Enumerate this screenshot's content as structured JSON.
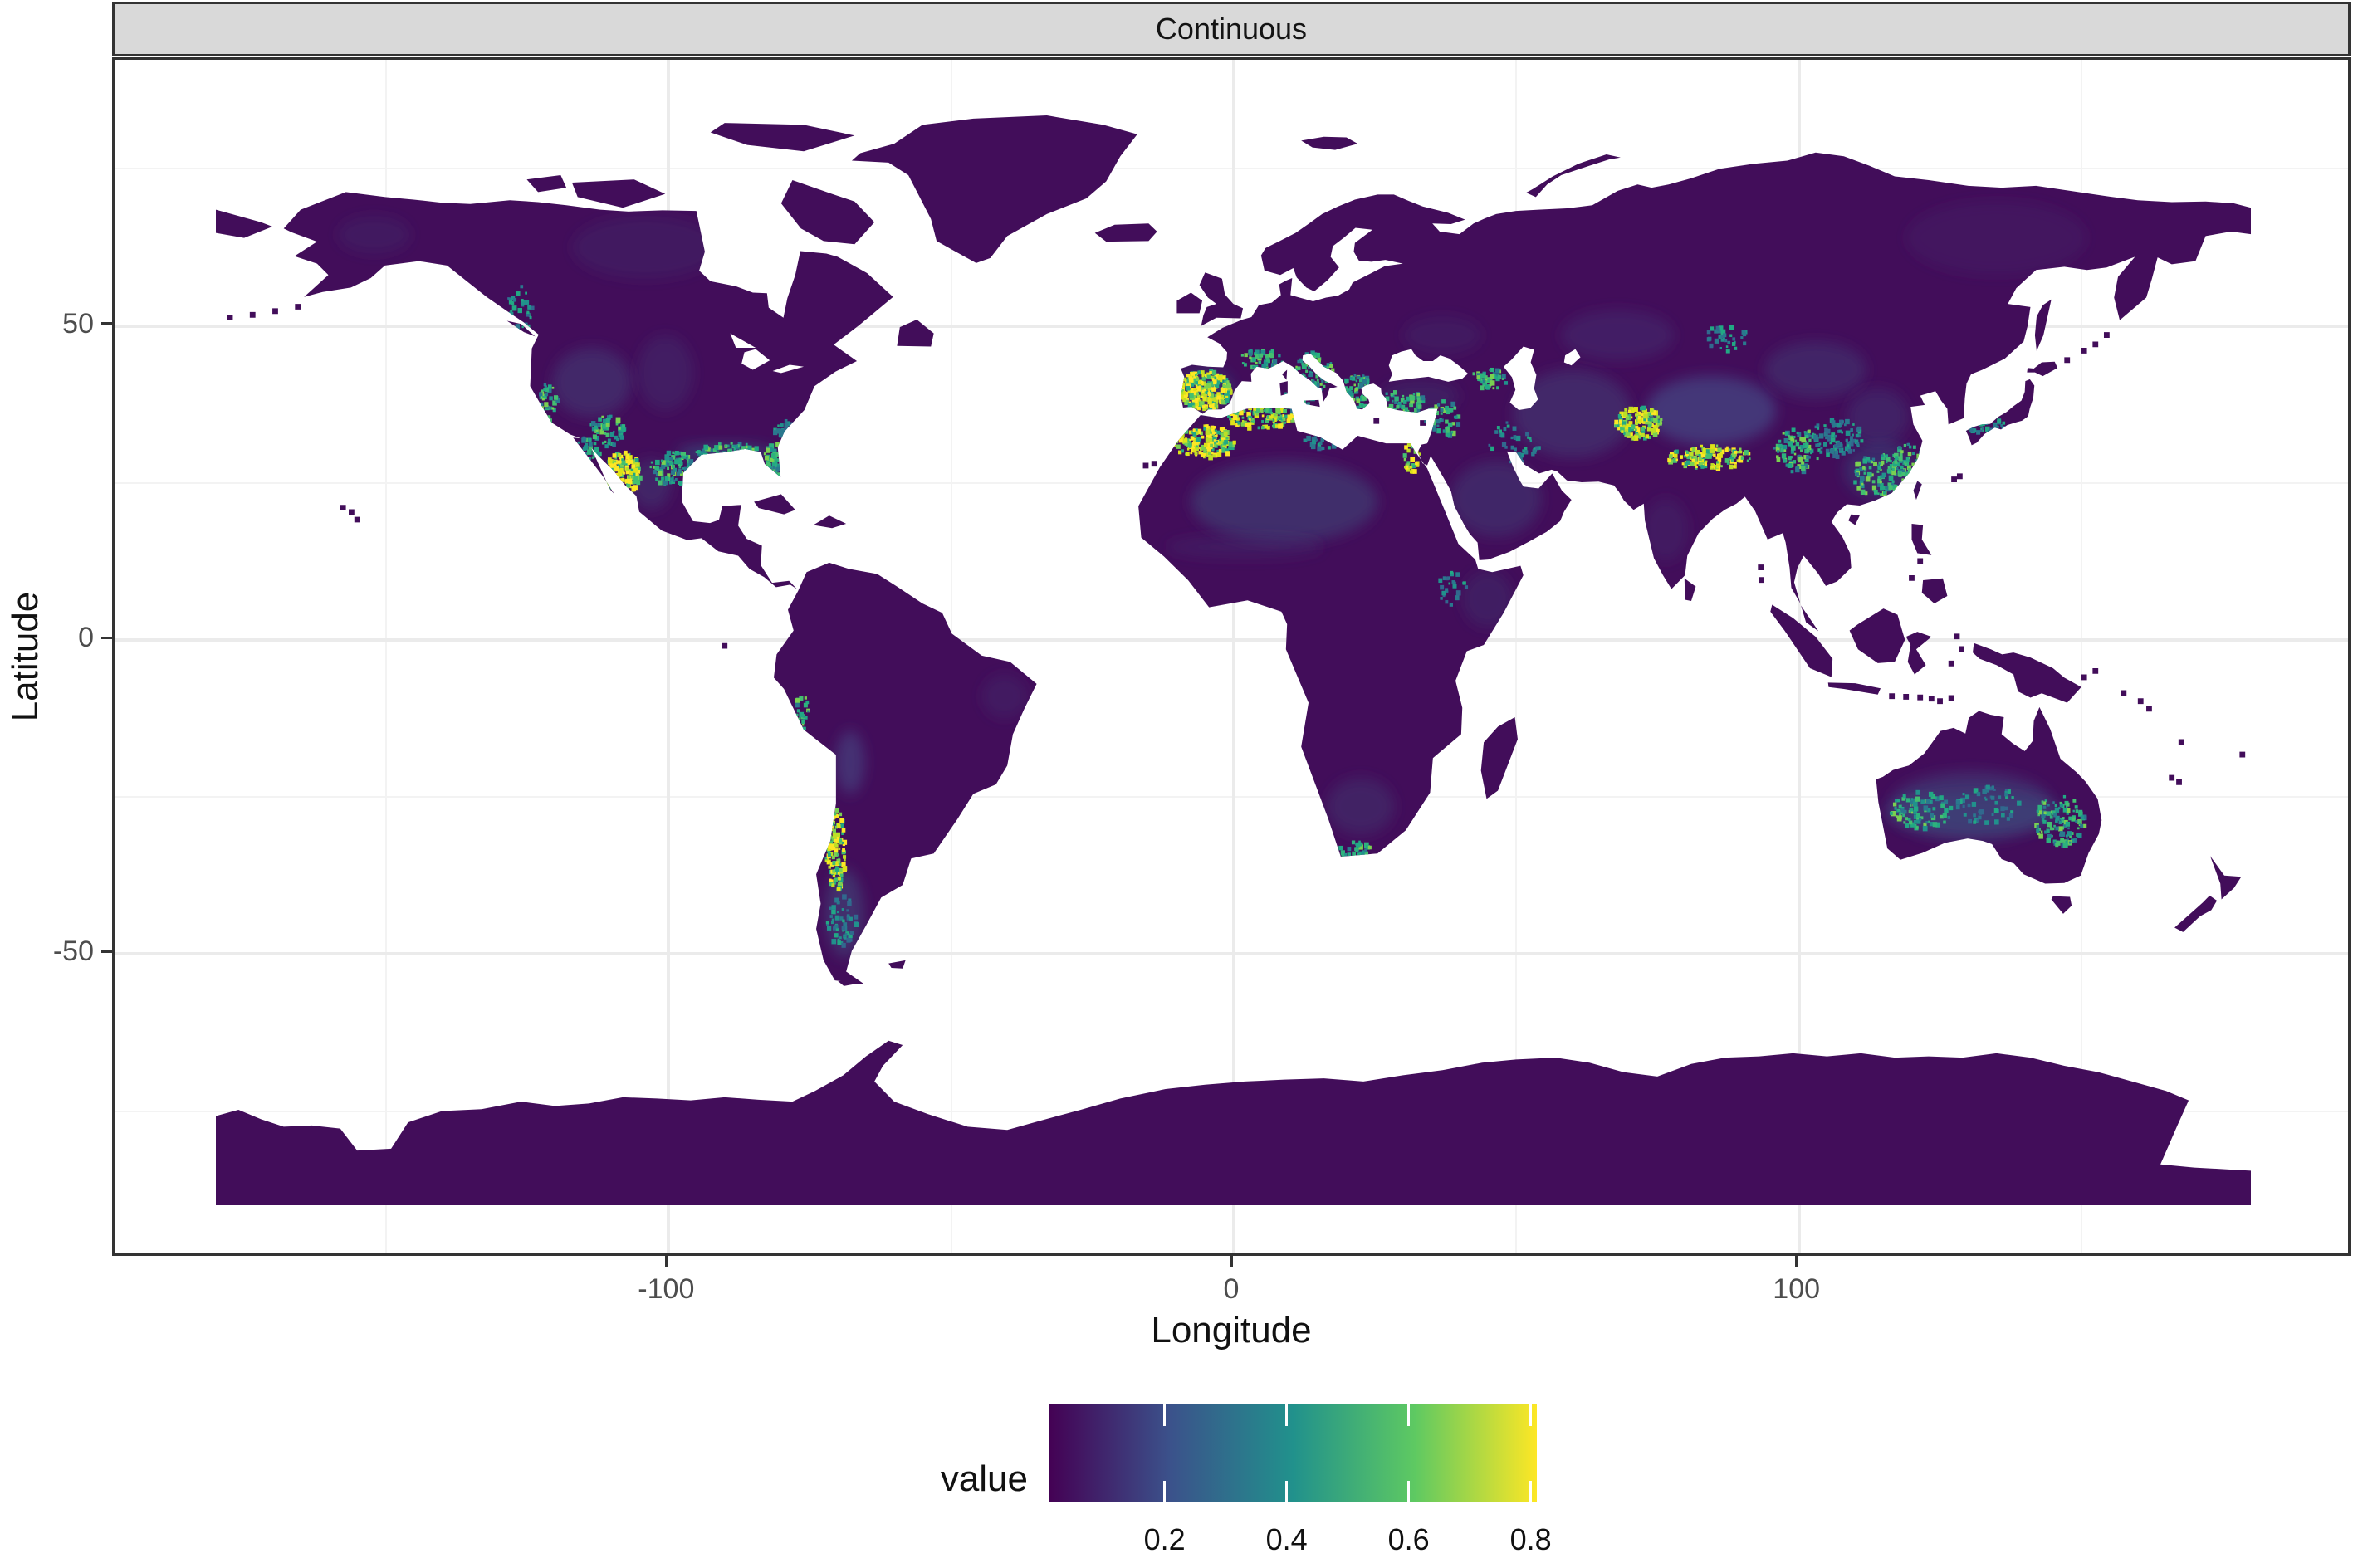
{
  "strip": {
    "label": "Continuous"
  },
  "axes": {
    "x": {
      "title": "Longitude",
      "breaks": [
        -100,
        0,
        100
      ],
      "labels": [
        "-100",
        "0",
        "100"
      ],
      "minor_breaks": [
        -150,
        -50,
        50,
        150
      ]
    },
    "y": {
      "title": "Latitude",
      "breaks": [
        50,
        0,
        -50
      ],
      "labels": [
        "50",
        "0",
        "-50"
      ],
      "minor_breaks": [
        75,
        25,
        -25,
        -75
      ]
    }
  },
  "legend": {
    "title": "value",
    "limits": [
      0.01,
      0.81
    ],
    "breaks": [
      0.2,
      0.4,
      0.6,
      0.8
    ],
    "labels": [
      "0.2",
      "0.4",
      "0.6",
      "0.8"
    ],
    "gradient": [
      [
        "0%",
        "#440154"
      ],
      [
        "25%",
        "#3b528b"
      ],
      [
        "50%",
        "#21918c"
      ],
      [
        "75%",
        "#5ec962"
      ],
      [
        "100%",
        "#fde725"
      ]
    ]
  },
  "colors": {
    "strip_bg": "#d9d9d9",
    "frame": "#333333",
    "grid_major": "#ebebeb",
    "grid_minor": "#f3f3f3",
    "tick_label": "#4d4d4d",
    "axis_title": "#111111",
    "land_base": "#420d5a",
    "ocean": "#ffffff"
  },
  "chart_data": {
    "type": "heatmap",
    "subtype": "geographic-raster-map",
    "projection": "equirectangular",
    "facet_label": "Continuous",
    "title": "",
    "xlabel": "Longitude",
    "ylabel": "Latitude",
    "xlim": [
      -180,
      180
    ],
    "ylim": [
      -90,
      83.64
    ],
    "x_breaks": [
      -100,
      0,
      100
    ],
    "y_breaks": [
      50,
      0,
      -50
    ],
    "grid": "on",
    "legend_position": "bottom",
    "legend_title": "value",
    "value_range": [
      0.01,
      0.81
    ],
    "legend_breaks": [
      0.2,
      0.4,
      0.6,
      0.8
    ],
    "palette": "viridis",
    "na_color": "#ffffff",
    "base_value": 0.05,
    "description": "Global raster of a continuous variable. Most land is near the palette minimum (dark purple). Elevated values (teal/green/yellow) cluster in Iberia, the Maghreb/Atlas, Italy/Turkey, SW USA and NW Mexico, the US Gulf coast, the central Chilean Andes, the Hindu Kush-Himalaya arc, central & SE China, and an east-west band across interior Australia.",
    "palettes": {
      "teal": [
        "#31688e",
        "#2a788e",
        "#2a788e",
        "#21918c",
        "#22a884"
      ],
      "tealGreen": [
        "#2a788e",
        "#21918c",
        "#22a884",
        "#2db27d",
        "#44bf70",
        "#7ad151"
      ],
      "greenYellow": [
        "#22a884",
        "#44bf70",
        "#7ad151",
        "#bddf26",
        "#dde318",
        "#fde725"
      ],
      "hot": [
        "#22a884",
        "#44bf70",
        "#7ad151",
        "#bddf26",
        "#fde725",
        "#fde725",
        "#dde318"
      ]
    },
    "hotspot_fields": [
      "name",
      "lon",
      "lat",
      "rx_deg",
      "ry_deg",
      "points",
      "palette"
    ],
    "hotspots": [
      [
        "iberia",
        -5.3,
        40,
        4.6,
        3.2,
        260,
        "hot"
      ],
      [
        "morocco-atlas",
        -5.5,
        31.8,
        5.5,
        2.6,
        180,
        "hot"
      ],
      [
        "algeria-tunisia-coast",
        4.5,
        35.7,
        6,
        1.7,
        110,
        "greenYellow"
      ],
      [
        "libya-coast",
        16,
        32,
        4,
        1.3,
        35,
        "teal"
      ],
      [
        "nile-valley",
        31.2,
        29.5,
        1.6,
        2.6,
        30,
        "greenYellow"
      ],
      [
        "italy",
        13.8,
        42.8,
        3.6,
        3.4,
        100,
        "tealGreen"
      ],
      [
        "sicily-sardinia",
        11,
        38.5,
        3.5,
        2,
        30,
        "tealGreen"
      ],
      [
        "balkans-greece",
        21.8,
        39.8,
        3.4,
        2.6,
        70,
        "tealGreen"
      ],
      [
        "turkey-west",
        29.5,
        38,
        4,
        2.2,
        60,
        "tealGreen"
      ],
      [
        "turkey-east-levant",
        36.5,
        35.5,
        3.5,
        3,
        55,
        "tealGreen"
      ],
      [
        "caucasus",
        45,
        41.8,
        3.2,
        1.6,
        45,
        "tealGreen"
      ],
      [
        "zagros",
        49.5,
        31.5,
        4.5,
        3.5,
        45,
        "teal"
      ],
      [
        "hindu-kush",
        71.5,
        34.8,
        4.2,
        2.6,
        150,
        "hot"
      ],
      [
        "himalaya",
        84,
        29.3,
        7.5,
        1.9,
        140,
        "hot"
      ],
      [
        "hengduan",
        99.5,
        30.5,
        4,
        3.6,
        95,
        "tealGreen"
      ],
      [
        "central-china",
        106.5,
        32.5,
        4.5,
        3,
        85,
        "teal"
      ],
      [
        "se-china",
        114.5,
        26.5,
        5.5,
        3.4,
        130,
        "tealGreen"
      ],
      [
        "china-coast",
        119,
        28.5,
        3,
        3,
        50,
        "tealGreen"
      ],
      [
        "japan-south",
        132.5,
        34.3,
        4.5,
        1.4,
        35,
        "teal"
      ],
      [
        "nw-mexico",
        -108.3,
        26.8,
        3.2,
        3.4,
        170,
        "hot"
      ],
      [
        "texas-ne-mexico",
        -99.5,
        27.5,
        3.8,
        2.8,
        90,
        "tealGreen"
      ],
      [
        "gulf-coast",
        -89.5,
        30.2,
        6,
        1.4,
        85,
        "tealGreen"
      ],
      [
        "florida",
        -81.6,
        28.8,
        1.6,
        3,
        55,
        "tealGreen"
      ],
      [
        "carolina-coast",
        -78,
        33.8,
        3.6,
        1.6,
        50,
        "teal"
      ],
      [
        "california",
        -121.5,
        37.8,
        1.7,
        3.4,
        45,
        "tealGreen"
      ],
      [
        "baja-border",
        -114.5,
        30.5,
        2.2,
        2,
        35,
        "tealGreen"
      ],
      [
        "us-southwest",
        -111,
        33.5,
        3.2,
        2.4,
        60,
        "tealGreen"
      ],
      [
        "chile-andes",
        -70.6,
        -33.5,
        1.7,
        6.8,
        130,
        "hot"
      ],
      [
        "patagonia-coast",
        -69.5,
        -44.5,
        2.6,
        4.2,
        55,
        "teal"
      ],
      [
        "peru-coast",
        -76.8,
        -11.5,
        1.7,
        3,
        25,
        "tealGreen"
      ],
      [
        "australia-west",
        121.5,
        -26.8,
        5.5,
        3,
        90,
        "tealGreen"
      ],
      [
        "australia-center",
        133,
        -26,
        6,
        3,
        55,
        "teal"
      ],
      [
        "australia-east",
        146,
        -28.5,
        4.6,
        4,
        115,
        "tealGreen"
      ],
      [
        "cape-town",
        21.5,
        -33.2,
        3.2,
        1.4,
        35,
        "tealGreen"
      ],
      [
        "ethiopia",
        38.5,
        8.5,
        2.6,
        2.6,
        25,
        "teal"
      ],
      [
        "altai",
        87,
        48.5,
        4,
        2.2,
        35,
        "teal"
      ],
      [
        "bc-coast",
        -126.5,
        53,
        2.2,
        3.6,
        35,
        "teal"
      ],
      [
        "pyrenees-alps",
        5,
        45,
        4,
        1.6,
        45,
        "tealGreen"
      ]
    ],
    "terrain_fields": [
      "name",
      "lon",
      "lat",
      "rx_deg",
      "ry_deg",
      "color",
      "opacity"
    ],
    "terrain_patches": [
      [
        "sahara",
        9,
        22,
        16.5,
        6.5,
        "#3f3a72",
        0.7
      ],
      [
        "sahel",
        2,
        14.8,
        14,
        1.8,
        "#3f3a72",
        0.3
      ],
      [
        "arabia",
        46.5,
        22.5,
        8,
        6,
        "#3f3a72",
        0.55
      ],
      [
        "horn-somalia",
        45,
        6.5,
        4.5,
        4.5,
        "#3f3a72",
        0.35
      ],
      [
        "iran-turan",
        60,
        36,
        10.5,
        7,
        "#413f78",
        0.5
      ],
      [
        "kazakh-steppe",
        68,
        48.5,
        10,
        4,
        "#413f78",
        0.35
      ],
      [
        "tibet",
        84.5,
        36.5,
        11.5,
        5.5,
        "#46518c",
        0.6
      ],
      [
        "gobi",
        103,
        43,
        9,
        4.5,
        "#413f78",
        0.45
      ],
      [
        "east-china-plain",
        114,
        35.5,
        5.5,
        4.5,
        "#413f78",
        0.4
      ],
      [
        "nw-us-basin",
        -113.5,
        41,
        7,
        5.5,
        "#413f78",
        0.5
      ],
      [
        "great-plains",
        -100.5,
        42.5,
        5,
        6,
        "#413f78",
        0.3
      ],
      [
        "mexican-plateau",
        -103,
        24.8,
        3.6,
        4,
        "#413f78",
        0.45
      ],
      [
        "patagonia",
        -68.8,
        -43.5,
        3.4,
        7,
        "#3d5a84",
        0.45
      ],
      [
        "altiplano",
        -67.8,
        -19.5,
        2.6,
        5,
        "#46518c",
        0.5
      ],
      [
        "caatinga",
        -40.5,
        -9,
        4,
        3.5,
        "#3f3a72",
        0.3
      ],
      [
        "southern-africa",
        22.5,
        -26.5,
        6,
        4.5,
        "#3f3a72",
        0.45
      ],
      [
        "australia-interior",
        130.5,
        -26.5,
        14.5,
        5.5,
        "#41497f",
        0.5
      ],
      [
        "australia-band",
        131,
        -27.5,
        16,
        3.5,
        "#2f6b8e",
        0.25
      ],
      [
        "india-deccan",
        76.5,
        17.5,
        4,
        5,
        "#3f3a72",
        0.3
      ],
      [
        "ukraine-steppe",
        37,
        48.5,
        7,
        3,
        "#3f3a72",
        0.25
      ],
      [
        "north-canada",
        -104,
        62.5,
        13,
        5,
        "#3f3a72",
        0.25
      ],
      [
        "alaska-interior",
        -152,
        64.5,
        6.5,
        3,
        "#3f3a72",
        0.25
      ],
      [
        "east-siberia",
        135,
        64,
        16,
        6,
        "#3f3a72",
        0.2
      ],
      [
        "gulf-band",
        -90,
        29.8,
        8.5,
        1.3,
        "#2f6b8e",
        0.5
      ],
      [
        "se-china-wash",
        114.5,
        27,
        6.5,
        4.5,
        "#2f6b8e",
        0.3
      ],
      [
        "anatolia-wash",
        33,
        38.8,
        7,
        2.6,
        "#3f3a72",
        0.35
      ],
      [
        "iberia-wash",
        -5,
        40,
        5,
        3.2,
        "#2f6b8e",
        0.35
      ]
    ]
  }
}
